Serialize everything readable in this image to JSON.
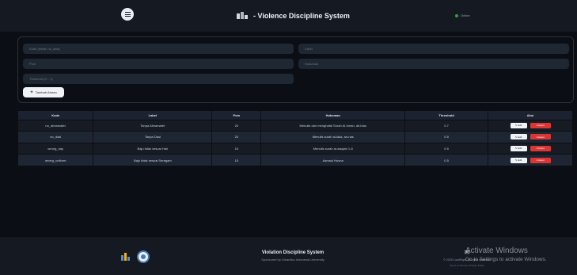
{
  "header": {
    "title": "- Violence Discipline System",
    "status": "Online"
  },
  "form": {
    "kode_placeholder": "Kode (misal: no_dasi)",
    "label_placeholder": "Label",
    "poin_placeholder": "Poin",
    "hukuman_placeholder": "Hukuman",
    "threshold_placeholder": "Threshold (0 - 1)",
    "add_label": "Tambah Aturan"
  },
  "table": {
    "columns": [
      "Kode",
      "Label",
      "Poin",
      "Hukuman",
      "Threshold",
      "Aksi"
    ],
    "rows": [
      {
        "kode": "no_almamater",
        "label": "Tanpa Almamater",
        "poin": "20",
        "hukuman": "Menulis dan menghafal Surah Al-Imran, ali-Idas",
        "threshold": "0.7"
      },
      {
        "kode": "no_dasi",
        "label": "Tanpa Dasi",
        "poin": "20",
        "hukuman": "Menulis surah al-idas, an-nas",
        "threshold": "0.5"
      },
      {
        "kode": "wrong_day",
        "label": "Baju tidak sesuai Hari",
        "poin": "15",
        "hukuman": "Menulis surah al-waqiah 1-8",
        "threshold": "0.5"
      },
      {
        "kode": "wrong_uniform",
        "label": "Baju tidak sesuai Seragam",
        "poin": "15",
        "hukuman": "Asmaul Husna",
        "threshold": "0.5"
      }
    ],
    "edit_label": "Edit",
    "delete_label": "Hapus"
  },
  "footer": {
    "title": "Violation Discipline System",
    "sponsor": "Sponsored by Dinamika Indonesia University",
    "copyright": "© 2025 LocalRight. All rights reserved.",
    "links": "Terms of Service | Privacy Policy"
  },
  "activation": {
    "title": "Activate Windows",
    "subtitle": "Go to Settings to activate Windows."
  },
  "colors": {
    "header_bg": "#141922",
    "page_bg": "#0b0e14",
    "online": "#2ea043",
    "delete": "#da3633"
  },
  "icons": [
    "menu-icon",
    "brand-icon",
    "plus-icon",
    "edit-icon",
    "trash-icon",
    "mail-icon"
  ]
}
